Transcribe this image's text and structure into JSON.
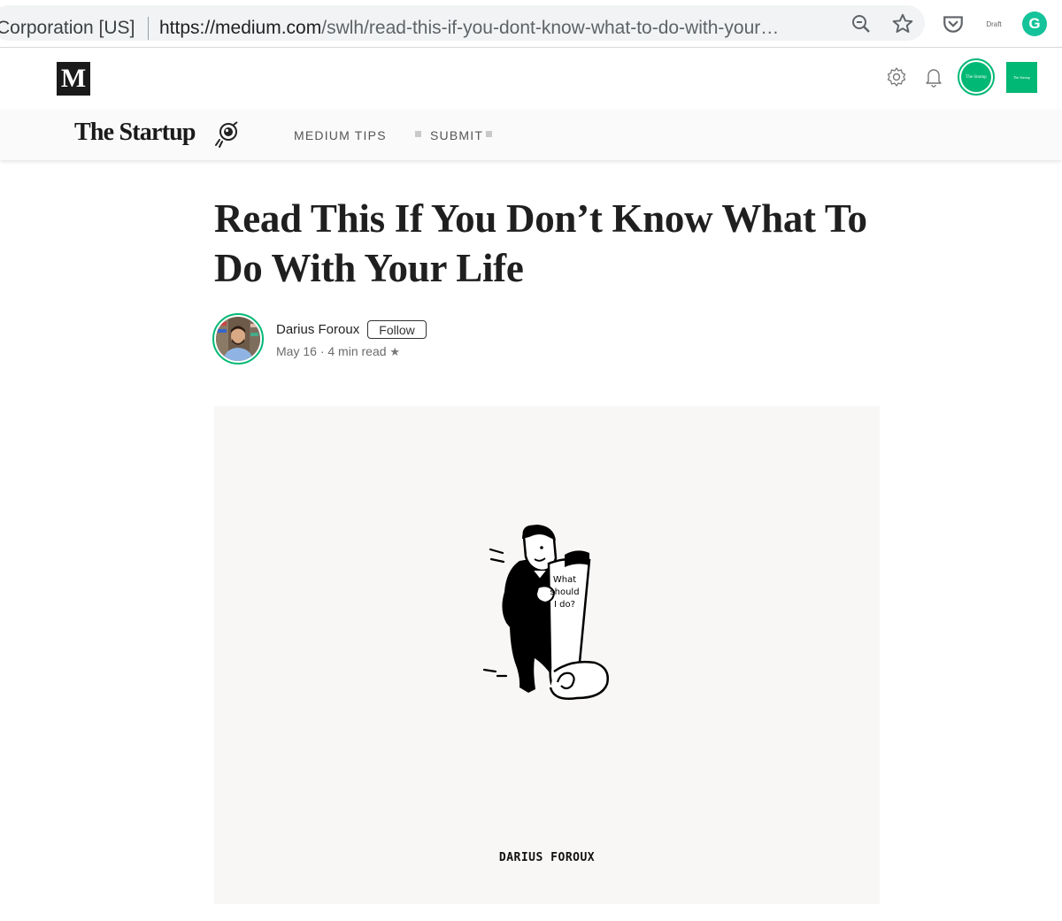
{
  "browser": {
    "org": "Corporation [US]",
    "url_host": "https://medium.com",
    "url_path": "/swlh/read-this-if-you-dont-know-what-to-do-with-your…",
    "draft_label": "Draft",
    "grammarly_letter": "G",
    "icons": [
      "zoom-icon",
      "star-icon",
      "pocket-icon",
      "grammarly-icon"
    ]
  },
  "medium": {
    "logo_letter": "M",
    "avatar_label": "The Startup",
    "pub_badge_label": "The Startup",
    "icons": [
      "gear-icon",
      "bell-icon"
    ]
  },
  "publication": {
    "name": "The Startup",
    "nav": [
      "MEDIUM TIPS",
      "SUBMIT"
    ]
  },
  "article": {
    "title": "Read This If You Don’t Know What To Do With Your Life",
    "author": "Darius Foroux",
    "follow_label": "Follow",
    "date": "May 16",
    "separator": "·",
    "read_time": "4 min read",
    "star": "★"
  },
  "hero": {
    "scroll_lines": [
      "What",
      "should",
      "I do?"
    ],
    "signature": "DARIUS FOROUX",
    "background": "#f8f7f5"
  },
  "colors": {
    "accent": "#02b875",
    "grammarly": "#15c39a"
  }
}
